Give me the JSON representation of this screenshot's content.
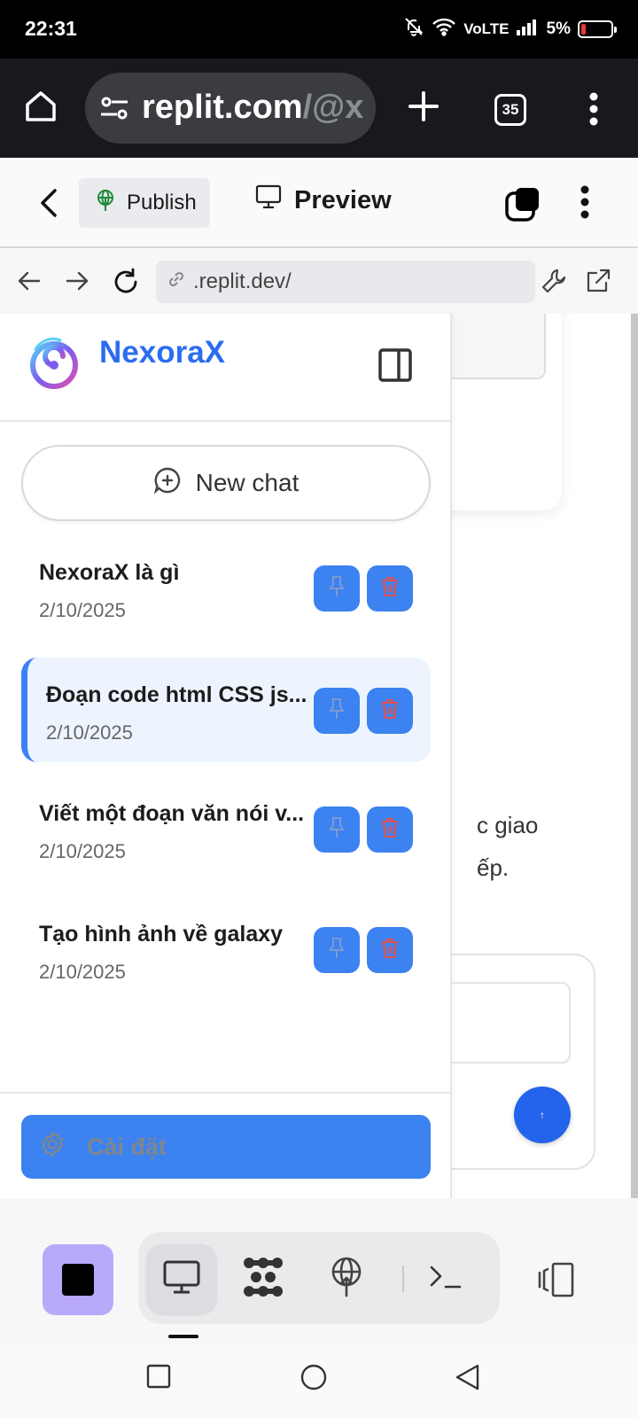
{
  "status_bar": {
    "time": "22:31",
    "network": "VoLTE",
    "battery": "5%",
    "battery_color": "#e53935"
  },
  "browser": {
    "url_main": "replit.com",
    "url_rest": "/@x",
    "tab_count": "35",
    "icons": [
      "home-icon",
      "site-settings-icon",
      "new-tab-icon",
      "tabs-icon",
      "menu-icon"
    ]
  },
  "replit_header": {
    "publish_label": "Publish",
    "preview_label": "Preview"
  },
  "address_bar": {
    "url": ".replit.dev/"
  },
  "sidebar": {
    "brand": "NexoraX",
    "brand_color": "#2b6cf0",
    "new_chat_label": "New chat",
    "chats": [
      {
        "title": "NexoraX là gì",
        "date": "2/10/2025",
        "active": false
      },
      {
        "title": "Đoạn code html CSS js...",
        "date": "2/10/2025",
        "active": true
      },
      {
        "title": "Viết một đoạn văn nói v...",
        "date": "2/10/2025",
        "active": false
      },
      {
        "title": "Tạo hình ảnh về galaxy",
        "date": "2/10/2025",
        "active": false
      }
    ],
    "settings_label": "Cài đặt",
    "accent_color": "#3c82f0",
    "delete_icon_color": "#e05252"
  },
  "background_page": {
    "line1": "c giao",
    "line2": "ếp."
  },
  "dock": {
    "stop_color": "#b8a9fb",
    "items": [
      "preview-icon",
      "agent-icon",
      "deploy-icon",
      "shell-icon"
    ]
  }
}
